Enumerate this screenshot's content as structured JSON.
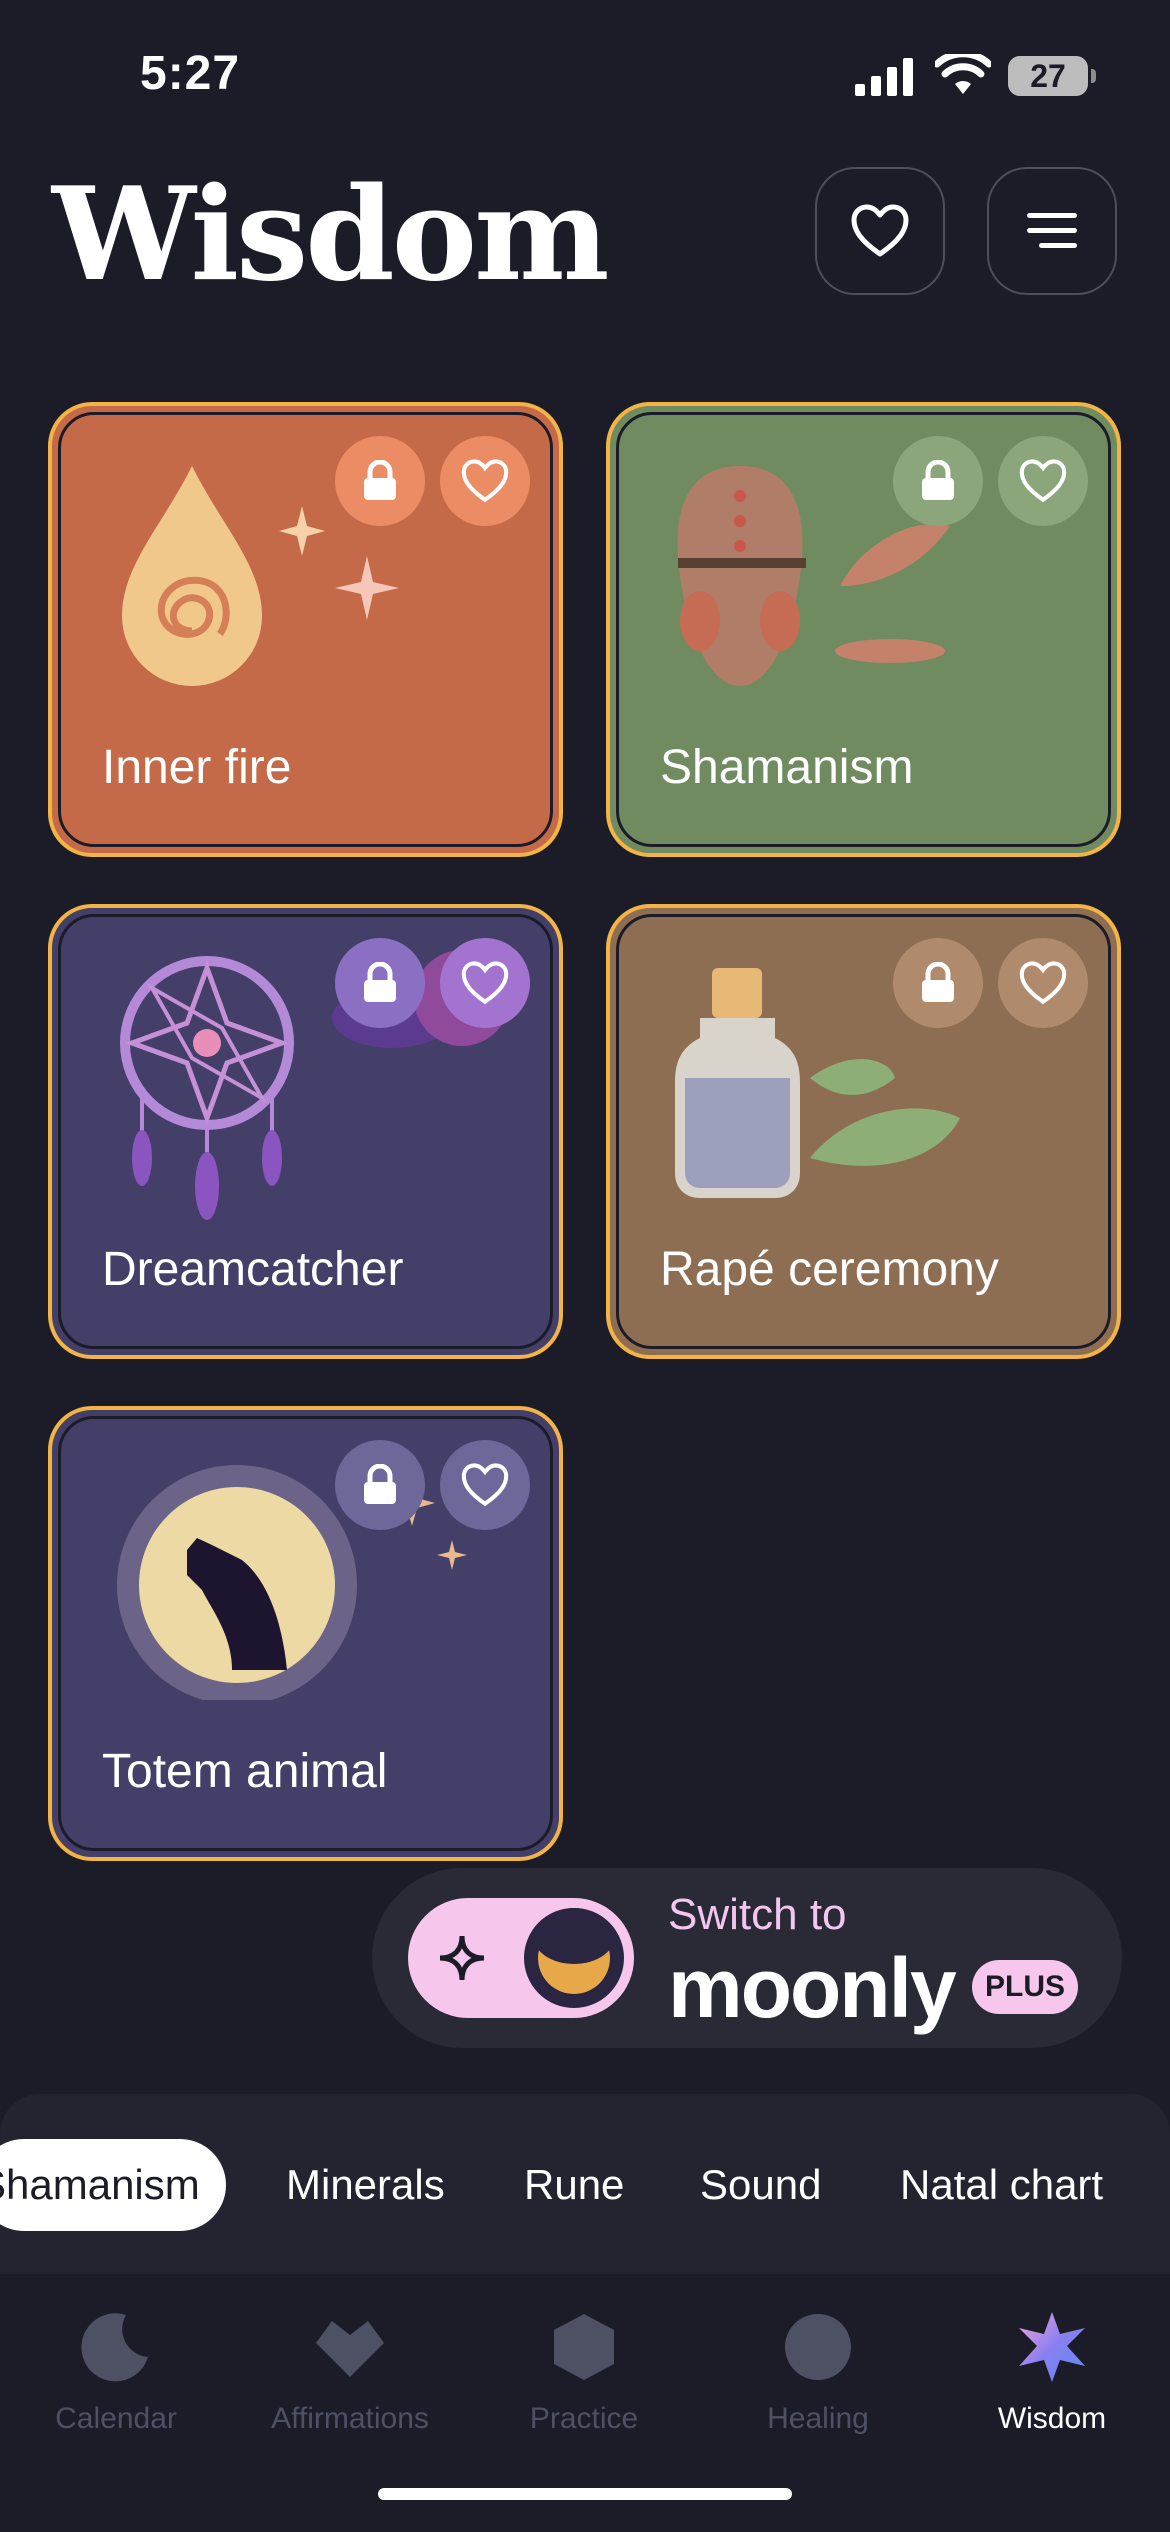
{
  "status_bar": {
    "time": "5:27",
    "battery": "27"
  },
  "header": {
    "title": "Wisdom"
  },
  "cards": [
    {
      "label": "Inner fire",
      "bg": "#c56a48"
    },
    {
      "label": "Shamanism",
      "bg": "#6f8b5f"
    },
    {
      "label": "Dreamcatcher",
      "bg": "#433f68"
    },
    {
      "label": "Rapé ceremony",
      "bg": "#8d6e53"
    },
    {
      "label": "Totem animal",
      "bg": "#433f68"
    }
  ],
  "promo": {
    "line1": "Switch to",
    "brand": "moonly",
    "badge": "PLUS"
  },
  "category_tabs": [
    "Shamanism",
    "Minerals",
    "Rune",
    "Sound",
    "Natal chart"
  ],
  "bottom_nav": [
    {
      "label": "Calendar",
      "icon": "moon-icon"
    },
    {
      "label": "Affirmations",
      "icon": "heart-icon"
    },
    {
      "label": "Practice",
      "icon": "hexagon-icon"
    },
    {
      "label": "Healing",
      "icon": "circle-icon"
    },
    {
      "label": "Wisdom",
      "icon": "star-icon"
    }
  ],
  "colors": {
    "accent_border": "#f2b445",
    "background": "#1b1c27",
    "pink": "#f6c6ec"
  }
}
